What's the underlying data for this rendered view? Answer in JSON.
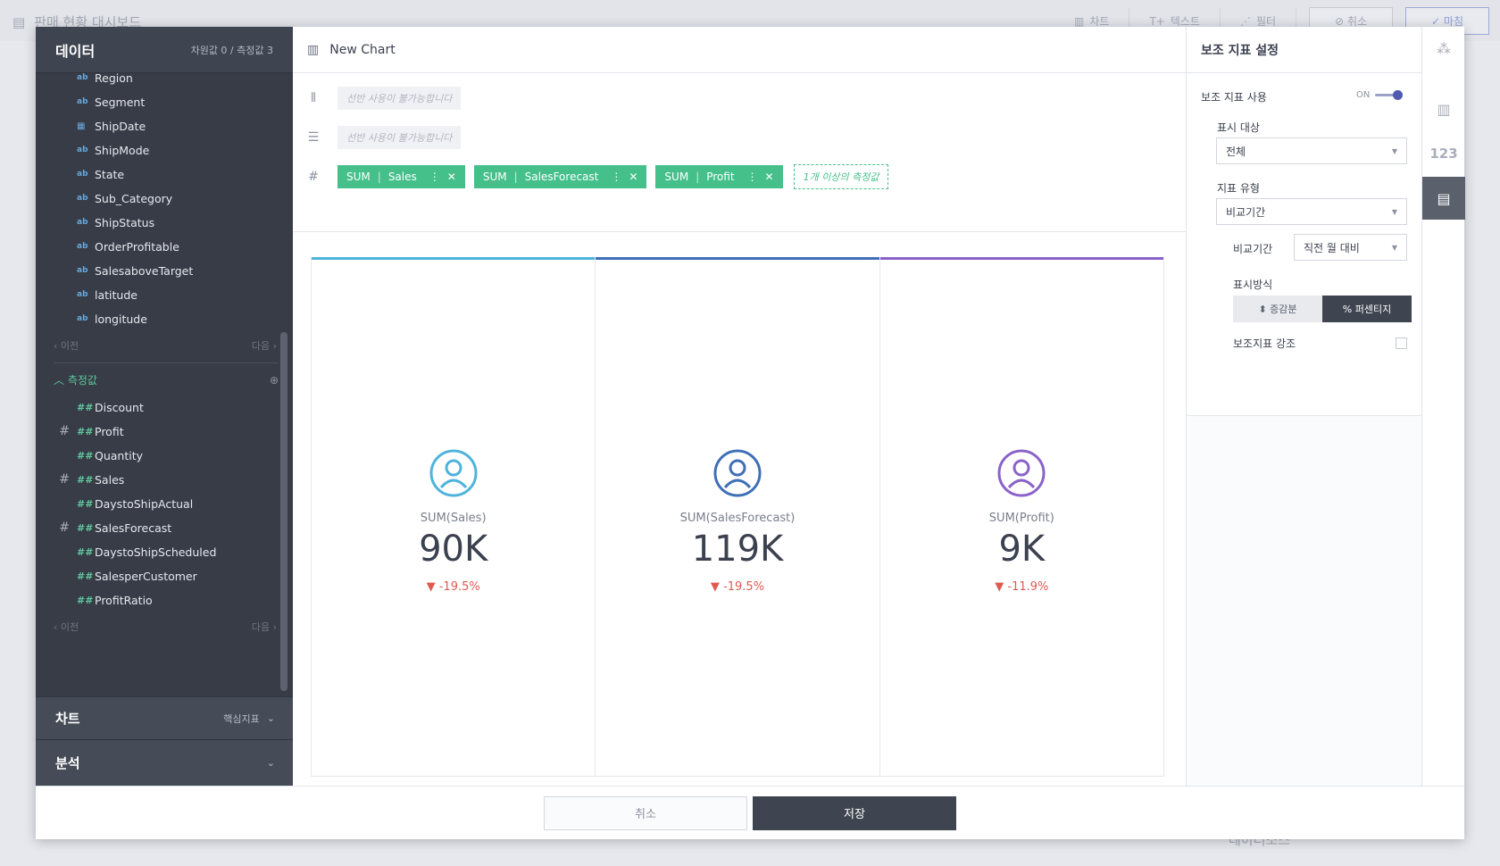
{
  "background": {
    "title": "판매 현황 대시보드",
    "tools": [
      {
        "icon": "chart-icon",
        "label": "차트"
      },
      {
        "icon": "text-icon",
        "label": "텍스트"
      },
      {
        "icon": "filter-icon",
        "label": "필터"
      }
    ],
    "cancel": "취소",
    "finish": "마침",
    "bottom_text": "데이터소스"
  },
  "left_panel": {
    "title": "데이터",
    "counts": "차원값 0 / 측정값 3",
    "dimensions": [
      {
        "type": "ab",
        "name": "Region"
      },
      {
        "type": "ab",
        "name": "Segment"
      },
      {
        "type": "date",
        "name": "ShipDate"
      },
      {
        "type": "ab",
        "name": "ShipMode"
      },
      {
        "type": "ab",
        "name": "State"
      },
      {
        "type": "ab",
        "name": "Sub_Category"
      },
      {
        "type": "ab",
        "name": "ShipStatus"
      },
      {
        "type": "ab",
        "name": "OrderProfitable"
      },
      {
        "type": "ab",
        "name": "SalesaboveTarget"
      },
      {
        "type": "ab",
        "name": "latitude"
      },
      {
        "type": "ab",
        "name": "longitude"
      }
    ],
    "prev": "이전",
    "next": "다음",
    "measures_header": "측정값",
    "measures": [
      {
        "pinned": false,
        "type": "##",
        "name": "Discount"
      },
      {
        "pinned": true,
        "type": "##",
        "name": "Profit"
      },
      {
        "pinned": false,
        "type": "##",
        "name": "Quantity"
      },
      {
        "pinned": true,
        "type": "##",
        "name": "Sales"
      },
      {
        "pinned": false,
        "type": "##",
        "name": "DaystoShipActual"
      },
      {
        "pinned": true,
        "type": "##",
        "name": "SalesForecast"
      },
      {
        "pinned": false,
        "type": "##",
        "name": "DaystoShipScheduled"
      },
      {
        "pinned": false,
        "type": "##",
        "name": "SalesperCustomer"
      },
      {
        "pinned": false,
        "type": "##",
        "name": "ProfitRatio"
      }
    ],
    "chart_section": "차트",
    "chart_type": "핵심지표",
    "analysis_section": "분석"
  },
  "center": {
    "title": "New Chart",
    "column_shelf_placeholder": "선반 사용이 불가능합니다",
    "row_shelf_placeholder": "선반 사용이 불가능합니다",
    "pills": [
      {
        "agg": "SUM",
        "field": "Sales"
      },
      {
        "agg": "SUM",
        "field": "SalesForecast"
      },
      {
        "agg": "SUM",
        "field": "Profit"
      }
    ],
    "add_hint": "1개 이상의 측정값",
    "cards": [
      {
        "label": "SUM(Sales)",
        "value": "90K",
        "change": "-19.5%",
        "color": "#4fb3dc"
      },
      {
        "label": "SUM(SalesForecast)",
        "value": "119K",
        "change": "-19.5%",
        "color": "#3f6fb6"
      },
      {
        "label": "SUM(Profit)",
        "value": "9K",
        "change": "-11.9%",
        "color": "#8a63c8"
      }
    ]
  },
  "right_panel": {
    "title": "보조 지표 설정",
    "use_label": "보조 지표 사용",
    "toggle": "ON",
    "target_label": "표시 대상",
    "target_value": "전체",
    "type_label": "지표 유형",
    "type_value": "비교기간",
    "period_label": "비교기간",
    "period_value": "직전 월 대비",
    "display_label": "표시방식",
    "seg_a": "증감분",
    "seg_b": "퍼센티지",
    "emphasis_label": "보조지표 강조"
  },
  "side_tabs": {
    "num_label": "123"
  },
  "footer": {
    "cancel": "취소",
    "save": "저장"
  }
}
